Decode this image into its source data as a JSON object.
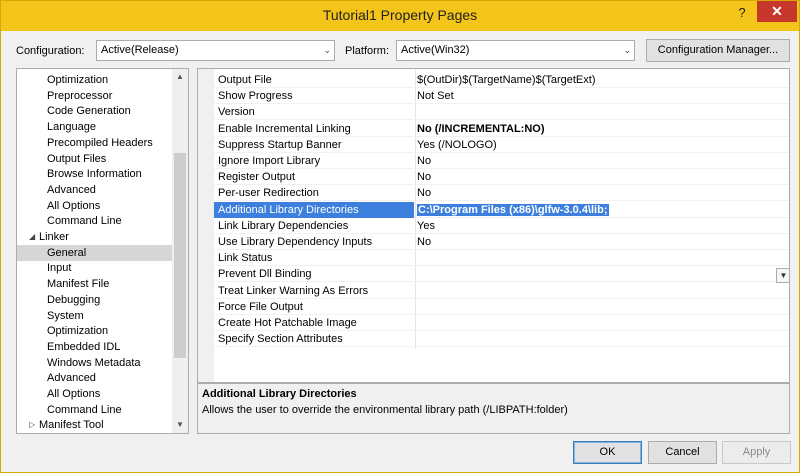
{
  "window": {
    "title": "Tutorial1 Property Pages",
    "help": "?",
    "close": "✕"
  },
  "toolbar": {
    "configuration_label": "Configuration:",
    "configuration_value": "Active(Release)",
    "platform_label": "Platform:",
    "platform_value": "Active(Win32)",
    "config_manager": "Configuration Manager..."
  },
  "tree": {
    "items": [
      {
        "label": "Optimization"
      },
      {
        "label": "Preprocessor"
      },
      {
        "label": "Code Generation"
      },
      {
        "label": "Language"
      },
      {
        "label": "Precompiled Headers"
      },
      {
        "label": "Output Files"
      },
      {
        "label": "Browse Information"
      },
      {
        "label": "Advanced"
      },
      {
        "label": "All Options"
      },
      {
        "label": "Command Line"
      },
      {
        "label": "Linker",
        "expander": "◢"
      },
      {
        "label": "General",
        "selected": true
      },
      {
        "label": "Input"
      },
      {
        "label": "Manifest File"
      },
      {
        "label": "Debugging"
      },
      {
        "label": "System"
      },
      {
        "label": "Optimization"
      },
      {
        "label": "Embedded IDL"
      },
      {
        "label": "Windows Metadata"
      },
      {
        "label": "Advanced"
      },
      {
        "label": "All Options"
      },
      {
        "label": "Command Line"
      },
      {
        "label": "Manifest Tool",
        "expander": "▷"
      }
    ]
  },
  "properties": [
    {
      "name": "Output File",
      "value": "$(OutDir)$(TargetName)$(TargetExt)"
    },
    {
      "name": "Show Progress",
      "value": "Not Set"
    },
    {
      "name": "Version",
      "value": ""
    },
    {
      "name": "Enable Incremental Linking",
      "value": "No (/INCREMENTAL:NO)",
      "bold": true
    },
    {
      "name": "Suppress Startup Banner",
      "value": "Yes (/NOLOGO)"
    },
    {
      "name": "Ignore Import Library",
      "value": "No"
    },
    {
      "name": "Register Output",
      "value": "No"
    },
    {
      "name": "Per-user Redirection",
      "value": "No"
    },
    {
      "name": "Additional Library Directories",
      "value": "C:\\Program Files (x86)\\glfw-3.0.4\\lib;",
      "selected": true
    },
    {
      "name": "Link Library Dependencies",
      "value": "Yes"
    },
    {
      "name": "Use Library Dependency Inputs",
      "value": "No"
    },
    {
      "name": "Link Status",
      "value": ""
    },
    {
      "name": "Prevent Dll Binding",
      "value": ""
    },
    {
      "name": "Treat Linker Warning As Errors",
      "value": ""
    },
    {
      "name": "Force File Output",
      "value": ""
    },
    {
      "name": "Create Hot Patchable Image",
      "value": ""
    },
    {
      "name": "Specify Section Attributes",
      "value": ""
    }
  ],
  "description": {
    "title": "Additional Library Directories",
    "text": "Allows the user to override the environmental library path (/LIBPATH:folder)"
  },
  "buttons": {
    "ok": "OK",
    "cancel": "Cancel",
    "apply": "Apply"
  },
  "icons": {
    "dropdown": "chevron-down-icon",
    "scroll_up": "chevron-up-icon",
    "scroll_down": "chevron-down-icon"
  },
  "colors": {
    "titlebar": "#f3c51a",
    "selection": "#3c7fdc",
    "close": "#c7372c"
  }
}
